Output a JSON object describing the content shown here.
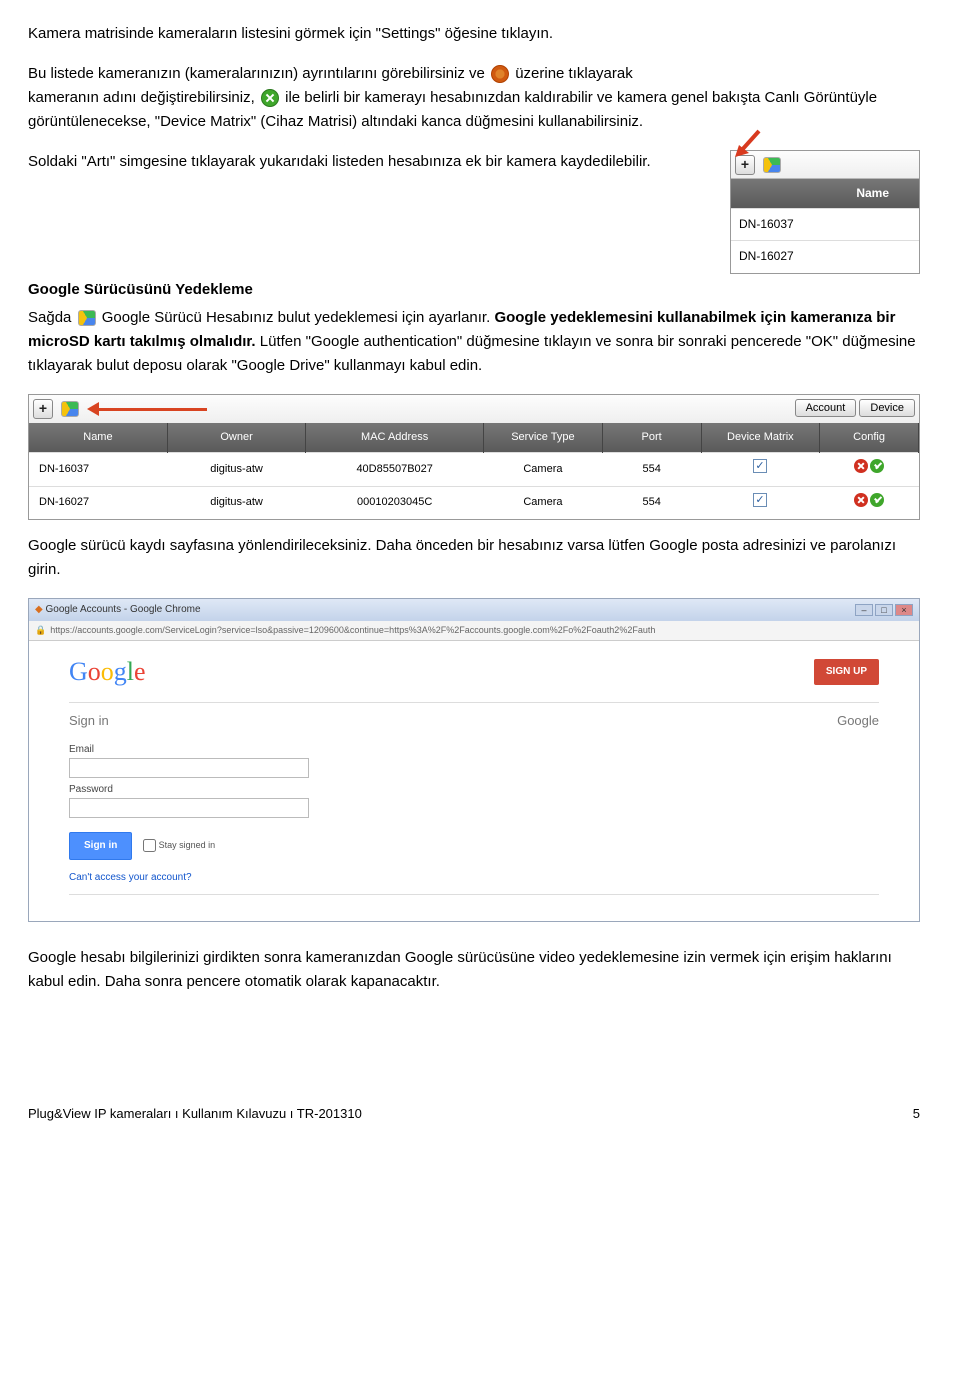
{
  "p1": "Kamera matrisinde kameraların listesini görmek için \"Settings\" öğesine tıklayın.",
  "p2a": "Bu listede kameranızın (kameralarınızın) ayrıntılarını görebilirsiniz ve ",
  "p2b": " üzerine tıklayarak",
  "p2c": "kameranın adını değiştirebilirsiniz, ",
  "p2d": " ile belirli bir kamerayı hesabınızdan kaldırabilir ve kamera genel bakışta Canlı Görüntüyle görüntülenecekse, \"Device Matrix\" (Cihaz Matrisi) altındaki kanca düğmesini kullanabilirsiniz.",
  "p3": "Soldaki \"Artı\" simgesine tıklayarak yukarıdaki listeden hesabınıza ek bir kamera kaydedilebilir.",
  "panel_name_header": "Name",
  "panel_rows": [
    "DN-16037",
    "DN-16027"
  ],
  "h_google": "Google Sürücüsünü Yedekleme",
  "p4a": "Sağda ",
  "p4b": " Google Sürücü Hesabınız bulut yedeklemesi için ayarlanır. ",
  "p4c": "Google yedeklemesini kullanabilmek için kameranıza bir microSD kartı takılmış olmalıdır.",
  "p4d": " Lütfen \"Google authentication\" düğmesine tıklayın ve sonra bir sonraki pencerede \"OK\" düğmesine tıklayarak bulut deposu olarak \"Google Drive\" kullanmayı kabul edin.",
  "buttons": {
    "account": "Account",
    "device": "Device"
  },
  "big_table": {
    "cols": [
      "Name",
      "Owner",
      "MAC Address",
      "Service Type",
      "Port",
      "Device Matrix",
      "Config"
    ],
    "rows": [
      {
        "name": "DN-16037",
        "owner": "digitus-atw",
        "mac": "40D85507B027",
        "stype": "Camera",
        "port": "554"
      },
      {
        "name": "DN-16027",
        "owner": "digitus-atw",
        "mac": "00010203045C",
        "stype": "Camera",
        "port": "554"
      }
    ]
  },
  "p5": "Google sürücü kaydı sayfasına yönlendirileceksiniz. Daha önceden bir hesabınız varsa lütfen Google posta adresinizi ve parolanızı girin.",
  "chrome": {
    "title": "Google Accounts - Google Chrome",
    "url": "https://accounts.google.com/ServiceLogin?service=lso&passive=1209600&continue=https%3A%2F%2Faccounts.google.com%2Fo%2Foauth2%2Fauth",
    "signup": "SIGN UP",
    "signin_h": "Sign in",
    "google_h": "Google",
    "email_l": "Email",
    "pass_l": "Password",
    "signin_btn": "Sign in",
    "stay": "Stay signed in",
    "cant": "Can't access your account?",
    "footer": "Google"
  },
  "p6": "Google hesabı bilgilerinizi girdikten sonra kameranızdan Google sürücüsüne video yedeklemesine izin vermek için erişim haklarını kabul edin. Daha sonra pencere otomatik olarak kapanacaktır.",
  "footer_left": "Plug&View IP kameraları ı Kullanım Kılavuzu ı TR-201310",
  "footer_right": "5"
}
